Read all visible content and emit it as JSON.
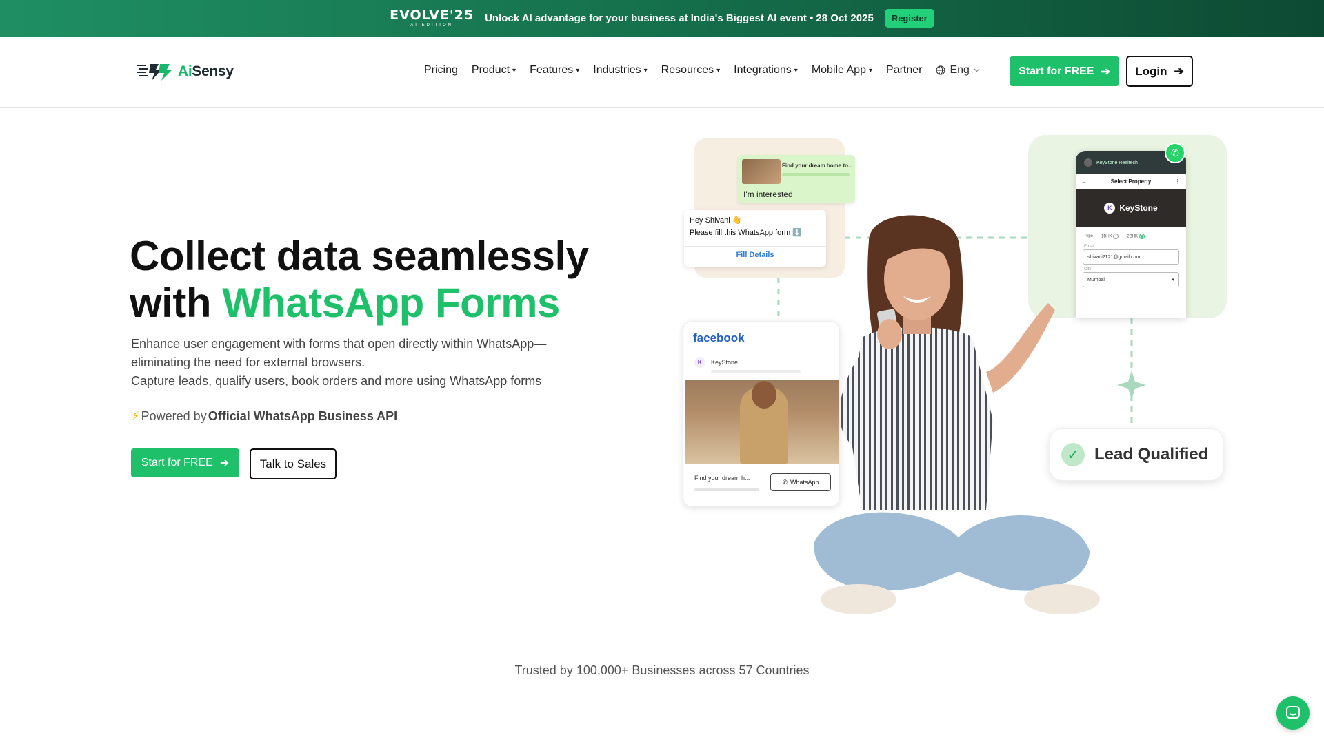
{
  "banner": {
    "event_name": "EVOLVE'25",
    "event_sub": "AI EDITION",
    "text": "Unlock AI advantage for your business at India's Biggest AI event • 28 Oct 2025",
    "register_label": "Register"
  },
  "nav": {
    "logo_ai": "Ai",
    "logo_rest": "Sensy",
    "items": [
      {
        "label": "Pricing",
        "caret": ""
      },
      {
        "label": "Product",
        "caret": "▾"
      },
      {
        "label": "Features",
        "caret": "▾"
      },
      {
        "label": "Industries",
        "caret": "▾"
      },
      {
        "label": "Resources",
        "caret": "▾"
      },
      {
        "label": "Integrations",
        "caret": "▾"
      },
      {
        "label": "Mobile App",
        "caret": "▾"
      },
      {
        "label": "Partner",
        "caret": ""
      }
    ],
    "language": "Eng",
    "start_label": "Start for FREE",
    "login_label": "Login"
  },
  "hero": {
    "title_line1": "Collect data seamlessly",
    "title_line2_prefix": "with ",
    "title_line2_highlight": "WhatsApp Forms",
    "desc_line1": "Enhance user engagement with forms that open directly within WhatsApp—",
    "desc_line2": "eliminating the need for external browsers.",
    "desc_line3": "Capture leads, qualify users, book orders and more using WhatsApp forms",
    "powered_prefix": "Powered by ",
    "powered_bold": "Official WhatsApp Business API",
    "start_label": "Start for FREE",
    "sales_label": "Talk to Sales"
  },
  "illustration": {
    "msg_preview": "Find your dream home to...",
    "msg_interested": "I'm interested",
    "msg_greeting": "Hey Shivani 👋",
    "msg_fill_form": "Please fill this WhatsApp form ⬇️",
    "msg_fill_details": "Fill Details",
    "fb_logo": "facebook",
    "fb_brand": "KeyStone",
    "fb_caption": "Find your dream h...",
    "fb_whatsapp": "WhatsApp",
    "phone_contact": "KeyStone Realtech",
    "phone_header": "Select Property",
    "phone_brand": "KeyStone",
    "phone_type_label": "Type",
    "phone_opt1": "1BHK",
    "phone_opt2": "2BHK",
    "phone_email_label": "Email",
    "phone_email_value": "shivani2121@gmail.com",
    "phone_city_label": "City",
    "phone_city_value": "Mumbai",
    "lead_label": "Lead Qualified"
  },
  "trusted": "Trusted by 100,000+ Businesses across 57 Countries",
  "colors": {
    "brand_green": "#1ec16a",
    "banner_dark": "#0d4a33"
  }
}
